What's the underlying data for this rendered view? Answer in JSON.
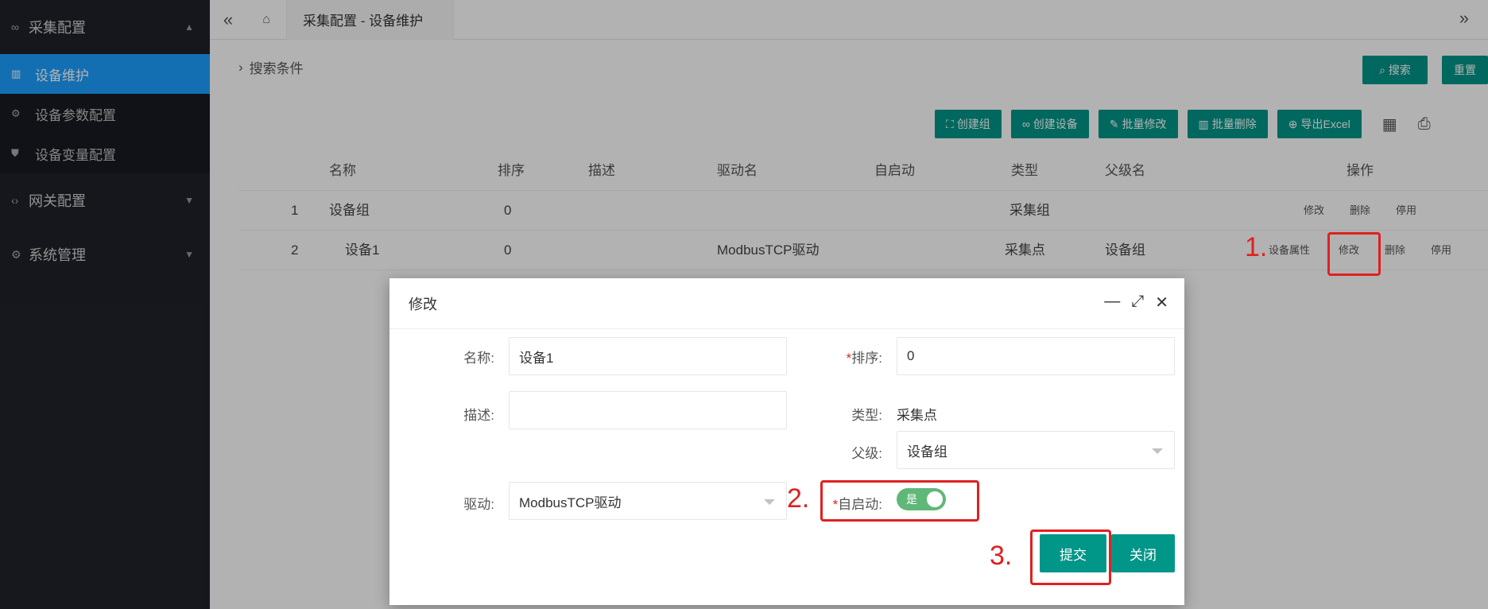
{
  "sidebar": {
    "groups": [
      {
        "label": "采集配置",
        "items": [
          "设备维护",
          "设备参数配置",
          "设备变量配置"
        ]
      },
      {
        "label": "网关配置"
      },
      {
        "label": "系统管理"
      }
    ]
  },
  "topbar": {
    "tab_title": "采集配置 - 设备维护"
  },
  "search": {
    "label": "搜索条件",
    "search_button": "搜索",
    "reset_button": "重置"
  },
  "toolbar": {
    "buttons": [
      "创建组",
      "创建设备",
      "批量修改",
      "批量删除",
      "导出Excel"
    ]
  },
  "table": {
    "headers": [
      "名称",
      "排序",
      "描述",
      "驱动名",
      "自启动",
      "类型",
      "父级名",
      "操作"
    ],
    "rows": [
      {
        "idx": "1",
        "name": "设备组",
        "order": "0",
        "desc": "",
        "driver": "",
        "auto": "",
        "type": "采集组",
        "parent": "",
        "ops": [
          "修改",
          "删除",
          "停用"
        ]
      },
      {
        "idx": "2",
        "name": "设备1",
        "order": "0",
        "desc": "",
        "driver": "ModbusTCP驱动",
        "auto": "",
        "type": "采集点",
        "parent": "设备组",
        "ops": [
          "设备属性",
          "修改",
          "删除",
          "停用"
        ]
      }
    ]
  },
  "marks": {
    "m1": "1.",
    "m2": "2.",
    "m3": "3."
  },
  "modal": {
    "title": "修改",
    "name_label": "名称:",
    "name_value": "设备1",
    "order_label": "排序:",
    "order_value": "0",
    "desc_label": "描述:",
    "desc_value": "",
    "type_label": "类型:",
    "type_value": "采集点",
    "parent_label": "父级:",
    "parent_value": "设备组",
    "driver_label": "驱动:",
    "driver_value": "ModbusTCP驱动",
    "auto_label": "自启动:",
    "auto_value": "是",
    "submit": "提交",
    "close": "关闭"
  },
  "colors": {
    "primary": "#009688",
    "switch_on": "#5fb878",
    "annotation": "#e02020",
    "sidebar": "#20222a",
    "sidebar_active": "#1e9fff"
  }
}
